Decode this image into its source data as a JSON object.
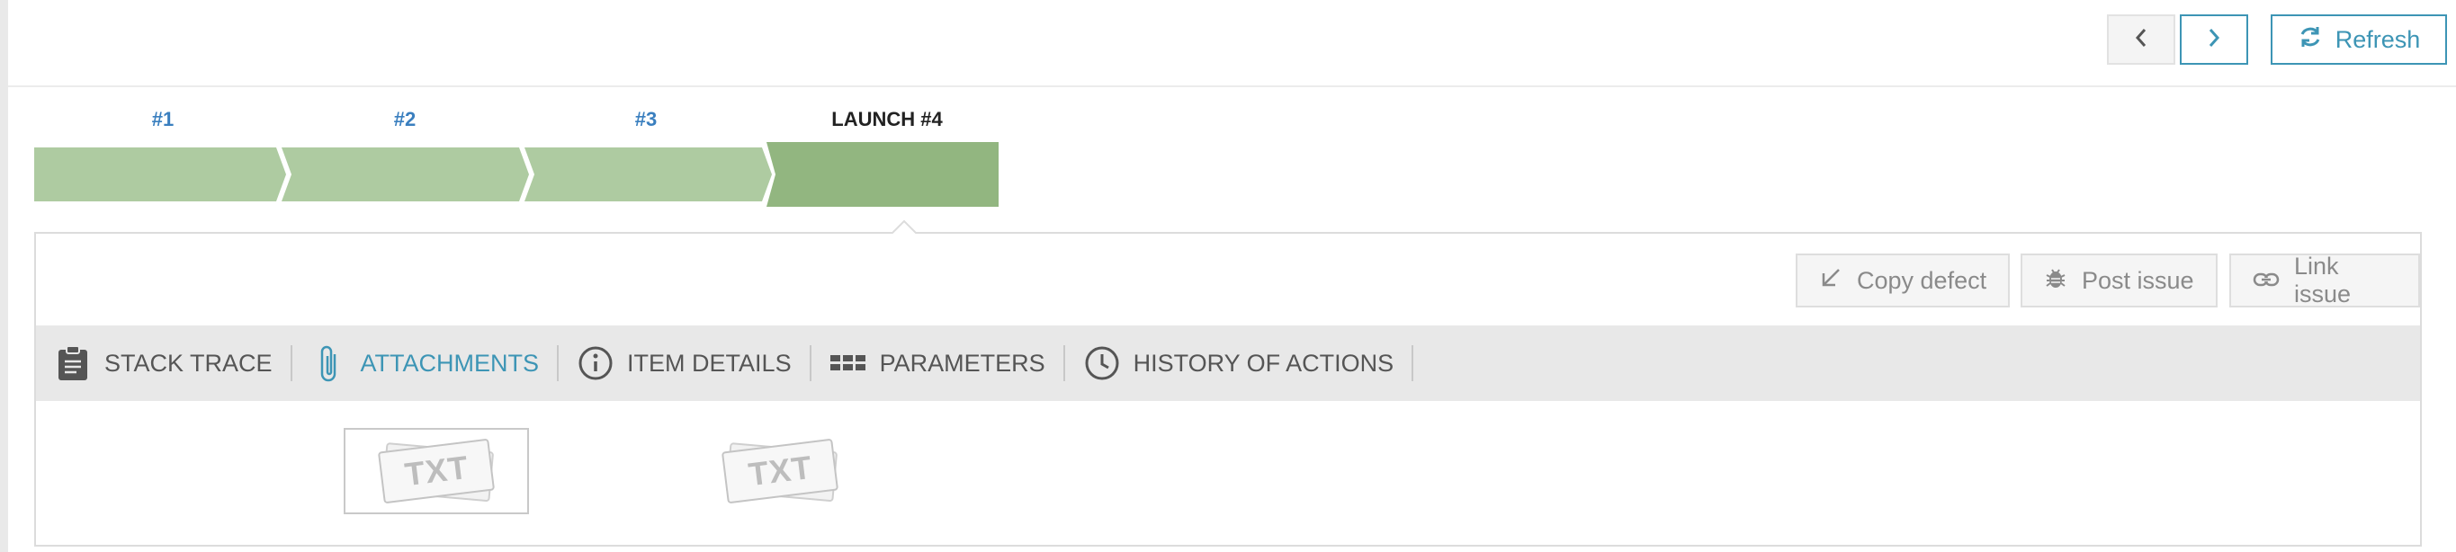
{
  "toolbar": {
    "prev_icon": "chevron-left-icon",
    "next_icon": "chevron-right-icon",
    "refresh_label": "Refresh",
    "refresh_icon": "refresh-icon"
  },
  "launches": [
    {
      "label": "#1",
      "current": false
    },
    {
      "label": "#2",
      "current": false
    },
    {
      "label": "#3",
      "current": false
    },
    {
      "label": "LAUNCH #4",
      "current": true
    }
  ],
  "actions": {
    "copy_defect": "Copy defect",
    "post_issue": "Post issue",
    "link_issue": "Link issue"
  },
  "tabs": [
    {
      "label": "STACK TRACE",
      "icon": "clipboard-icon",
      "active": false
    },
    {
      "label": "ATTACHMENTS",
      "icon": "paperclip-icon",
      "active": true
    },
    {
      "label": "ITEM DETAILS",
      "icon": "info-icon",
      "active": false
    },
    {
      "label": "PARAMETERS",
      "icon": "grid-icon",
      "active": false
    },
    {
      "label": "HISTORY OF ACTIONS",
      "icon": "clock-icon",
      "active": false
    }
  ],
  "attachments": [
    {
      "type": "TXT",
      "selected": true
    },
    {
      "type": "TXT",
      "selected": false
    }
  ],
  "colors": {
    "accent": "#3d95b5",
    "link_blue": "#3a7fbf",
    "launch_passed": "#aecba1",
    "launch_current": "#92b680"
  }
}
